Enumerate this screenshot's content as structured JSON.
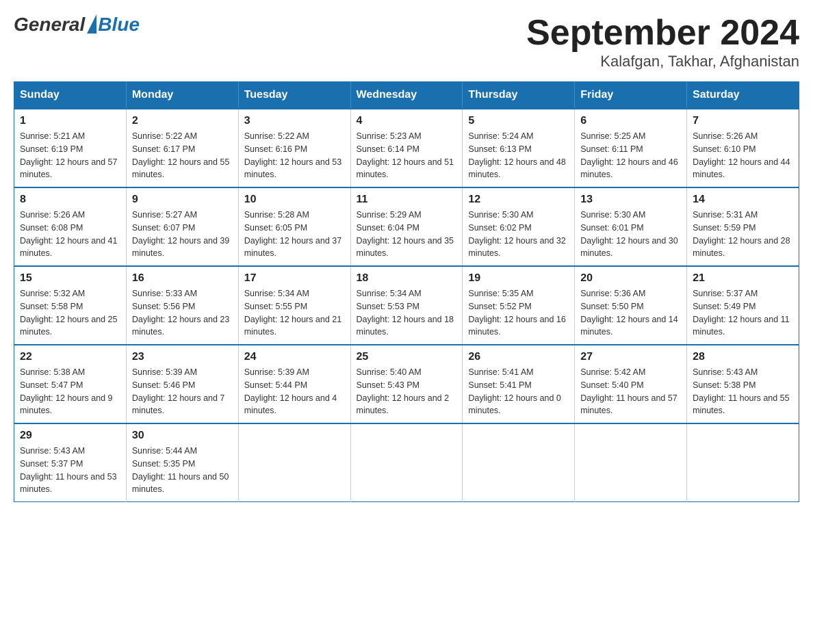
{
  "logo": {
    "text_general": "General",
    "text_blue": "Blue"
  },
  "title": "September 2024",
  "subtitle": "Kalafgan, Takhar, Afghanistan",
  "header_color": "#1a6faf",
  "days_of_week": [
    "Sunday",
    "Monday",
    "Tuesday",
    "Wednesday",
    "Thursday",
    "Friday",
    "Saturday"
  ],
  "weeks": [
    [
      {
        "day": "1",
        "sunrise": "5:21 AM",
        "sunset": "6:19 PM",
        "daylight": "12 hours and 57 minutes."
      },
      {
        "day": "2",
        "sunrise": "5:22 AM",
        "sunset": "6:17 PM",
        "daylight": "12 hours and 55 minutes."
      },
      {
        "day": "3",
        "sunrise": "5:22 AM",
        "sunset": "6:16 PM",
        "daylight": "12 hours and 53 minutes."
      },
      {
        "day": "4",
        "sunrise": "5:23 AM",
        "sunset": "6:14 PM",
        "daylight": "12 hours and 51 minutes."
      },
      {
        "day": "5",
        "sunrise": "5:24 AM",
        "sunset": "6:13 PM",
        "daylight": "12 hours and 48 minutes."
      },
      {
        "day": "6",
        "sunrise": "5:25 AM",
        "sunset": "6:11 PM",
        "daylight": "12 hours and 46 minutes."
      },
      {
        "day": "7",
        "sunrise": "5:26 AM",
        "sunset": "6:10 PM",
        "daylight": "12 hours and 44 minutes."
      }
    ],
    [
      {
        "day": "8",
        "sunrise": "5:26 AM",
        "sunset": "6:08 PM",
        "daylight": "12 hours and 41 minutes."
      },
      {
        "day": "9",
        "sunrise": "5:27 AM",
        "sunset": "6:07 PM",
        "daylight": "12 hours and 39 minutes."
      },
      {
        "day": "10",
        "sunrise": "5:28 AM",
        "sunset": "6:05 PM",
        "daylight": "12 hours and 37 minutes."
      },
      {
        "day": "11",
        "sunrise": "5:29 AM",
        "sunset": "6:04 PM",
        "daylight": "12 hours and 35 minutes."
      },
      {
        "day": "12",
        "sunrise": "5:30 AM",
        "sunset": "6:02 PM",
        "daylight": "12 hours and 32 minutes."
      },
      {
        "day": "13",
        "sunrise": "5:30 AM",
        "sunset": "6:01 PM",
        "daylight": "12 hours and 30 minutes."
      },
      {
        "day": "14",
        "sunrise": "5:31 AM",
        "sunset": "5:59 PM",
        "daylight": "12 hours and 28 minutes."
      }
    ],
    [
      {
        "day": "15",
        "sunrise": "5:32 AM",
        "sunset": "5:58 PM",
        "daylight": "12 hours and 25 minutes."
      },
      {
        "day": "16",
        "sunrise": "5:33 AM",
        "sunset": "5:56 PM",
        "daylight": "12 hours and 23 minutes."
      },
      {
        "day": "17",
        "sunrise": "5:34 AM",
        "sunset": "5:55 PM",
        "daylight": "12 hours and 21 minutes."
      },
      {
        "day": "18",
        "sunrise": "5:34 AM",
        "sunset": "5:53 PM",
        "daylight": "12 hours and 18 minutes."
      },
      {
        "day": "19",
        "sunrise": "5:35 AM",
        "sunset": "5:52 PM",
        "daylight": "12 hours and 16 minutes."
      },
      {
        "day": "20",
        "sunrise": "5:36 AM",
        "sunset": "5:50 PM",
        "daylight": "12 hours and 14 minutes."
      },
      {
        "day": "21",
        "sunrise": "5:37 AM",
        "sunset": "5:49 PM",
        "daylight": "12 hours and 11 minutes."
      }
    ],
    [
      {
        "day": "22",
        "sunrise": "5:38 AM",
        "sunset": "5:47 PM",
        "daylight": "12 hours and 9 minutes."
      },
      {
        "day": "23",
        "sunrise": "5:39 AM",
        "sunset": "5:46 PM",
        "daylight": "12 hours and 7 minutes."
      },
      {
        "day": "24",
        "sunrise": "5:39 AM",
        "sunset": "5:44 PM",
        "daylight": "12 hours and 4 minutes."
      },
      {
        "day": "25",
        "sunrise": "5:40 AM",
        "sunset": "5:43 PM",
        "daylight": "12 hours and 2 minutes."
      },
      {
        "day": "26",
        "sunrise": "5:41 AM",
        "sunset": "5:41 PM",
        "daylight": "12 hours and 0 minutes."
      },
      {
        "day": "27",
        "sunrise": "5:42 AM",
        "sunset": "5:40 PM",
        "daylight": "11 hours and 57 minutes."
      },
      {
        "day": "28",
        "sunrise": "5:43 AM",
        "sunset": "5:38 PM",
        "daylight": "11 hours and 55 minutes."
      }
    ],
    [
      {
        "day": "29",
        "sunrise": "5:43 AM",
        "sunset": "5:37 PM",
        "daylight": "11 hours and 53 minutes."
      },
      {
        "day": "30",
        "sunrise": "5:44 AM",
        "sunset": "5:35 PM",
        "daylight": "11 hours and 50 minutes."
      },
      null,
      null,
      null,
      null,
      null
    ]
  ]
}
